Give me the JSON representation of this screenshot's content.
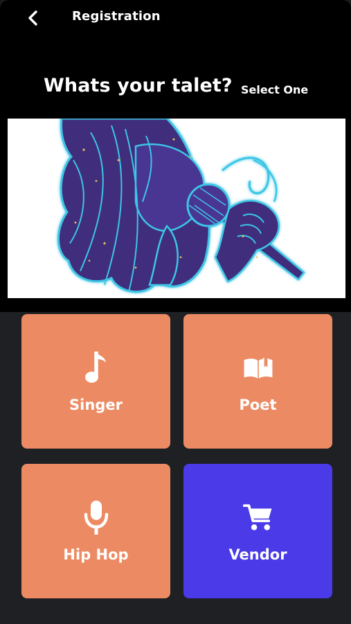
{
  "app_bar": {
    "back_icon": "chevron-left-icon",
    "title": "Registration"
  },
  "heading": {
    "title": "Whats your talet?",
    "subtitle": "Select One"
  },
  "hero_image": {
    "icon": "singer-illustration"
  },
  "options": [
    {
      "label": "Singer",
      "icon": "music-note-icon",
      "color": "#ec8b63",
      "selected": false
    },
    {
      "label": "Poet",
      "icon": "open-book-icon",
      "color": "#ec8b63",
      "selected": false
    },
    {
      "label": "Hip Hop",
      "icon": "microphone-icon",
      "color": "#ec8b63",
      "selected": false
    },
    {
      "label": "Vendor",
      "icon": "shopping-cart-icon",
      "color": "#4a3ae8",
      "selected": true
    }
  ],
  "colors": {
    "top_background": "#000000",
    "bottom_background": "#1e2024",
    "tile_default": "#ec8b63",
    "tile_selected": "#4a3ae8",
    "illustration_fill": "#3f2d7c",
    "illustration_glow": "#3cc6e6"
  }
}
